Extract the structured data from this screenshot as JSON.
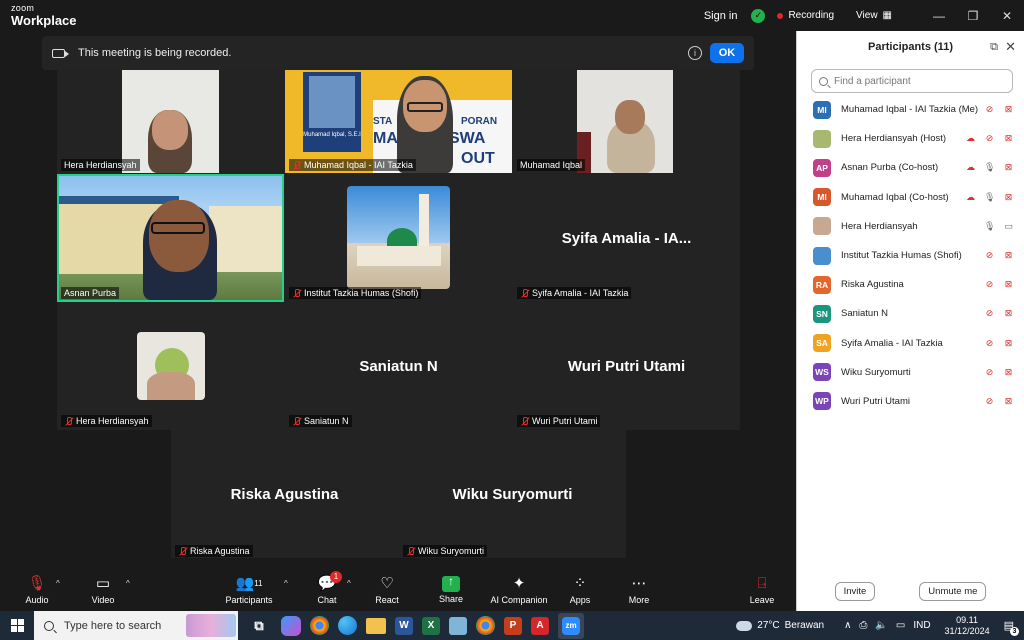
{
  "window": {
    "logo_line1": "zoom",
    "logo_line2": "Workplace",
    "sign_in": "Sign in",
    "recording_label": "Recording",
    "view_label": "View"
  },
  "banner": {
    "text": "This meeting is being recorded.",
    "ok_label": "OK"
  },
  "tiles": [
    {
      "name": "Hera Herdiansyah",
      "muted": false
    },
    {
      "name": "Muhamad Iqbal - IAI Tazkia",
      "muted": true
    },
    {
      "name": "Muhamad Iqbal",
      "muted": false
    },
    {
      "name": "Asnan Purba",
      "muted": false,
      "active": true
    },
    {
      "name": "Institut Tazkia Humas (Shofi)",
      "muted": true
    },
    {
      "name": "Syifa Amalia - IAI Tazkia",
      "muted": true,
      "display": "Syifa Amalia - IA..."
    },
    {
      "name": "Hera Herdiansyah",
      "muted": true
    },
    {
      "name": "Saniatun N",
      "muted": true,
      "display": "Saniatun N"
    },
    {
      "name": "Wuri Putri Utami",
      "muted": true,
      "display": "Wuri Putri Utami"
    },
    {
      "name": "Riska Agustina",
      "muted": true,
      "display": "Riska Agustina"
    },
    {
      "name": "Wiku Suryomurti",
      "muted": true,
      "display": "Wiku Suryomurti"
    }
  ],
  "slide_text": {
    "line1": "STA",
    "line2": "PORAN",
    "line3": "MA",
    "line4": "SWA",
    "line5": "OUT",
    "card_name": "Muhamad Iqbal, S.E.I"
  },
  "panel": {
    "title": "Participants (11)",
    "search_placeholder": "Find a participant",
    "invite_label": "Invite",
    "unmute_label": "Unmute me",
    "participants": [
      {
        "initials": "MI",
        "color": "#2d6fb5",
        "name": "Muhamad Iqbal - IAI Tazkia (Me)",
        "icons": [
          "mic-off",
          "video-off"
        ],
        "rec": false,
        "photo": false
      },
      {
        "initials": "",
        "color": "#a8b870",
        "name": "Hera Herdiansyah (Host)",
        "icons": [
          "mic-off",
          "video-off"
        ],
        "rec": true,
        "photo": true
      },
      {
        "initials": "AP",
        "color": "#c0408a",
        "name": "Asnan Purba (Co-host)",
        "icons": [
          "mic-on",
          "video-off"
        ],
        "rec": true,
        "photo": false
      },
      {
        "initials": "MI",
        "color": "#d9582b",
        "name": "Muhamad Iqbal (Co-host)",
        "icons": [
          "mic-on",
          "video-off"
        ],
        "rec": true,
        "photo": false
      },
      {
        "initials": "",
        "color": "#c8a890",
        "name": "Hera Herdiansyah",
        "icons": [
          "mic-on",
          "video-on"
        ],
        "rec": false,
        "photo": true
      },
      {
        "initials": "",
        "color": "#4a8ed0",
        "name": "Institut Tazkia Humas (Shofi)",
        "icons": [
          "mic-off",
          "video-off"
        ],
        "rec": false,
        "photo": true
      },
      {
        "initials": "RA",
        "color": "#e3672b",
        "name": "Riska Agustina",
        "icons": [
          "mic-off",
          "video-off"
        ],
        "rec": false,
        "photo": false
      },
      {
        "initials": "SN",
        "color": "#19967c",
        "name": "Saniatun N",
        "icons": [
          "mic-off",
          "video-off"
        ],
        "rec": false,
        "photo": false
      },
      {
        "initials": "SA",
        "color": "#efa321",
        "name": "Syifa Amalia - IAI Tazkia",
        "icons": [
          "mic-off",
          "video-off"
        ],
        "rec": false,
        "photo": false
      },
      {
        "initials": "WS",
        "color": "#7b45b8",
        "name": "Wiku Suryomurti",
        "icons": [
          "mic-off",
          "video-off"
        ],
        "rec": false,
        "photo": false
      },
      {
        "initials": "WP",
        "color": "#7b45b8",
        "name": "Wuri Putri Utami",
        "icons": [
          "mic-off",
          "video-off"
        ],
        "rec": false,
        "photo": false
      }
    ]
  },
  "toolbar": {
    "audio": "Audio",
    "video": "Video",
    "participants": "Participants",
    "participants_count": "11",
    "chat": "Chat",
    "chat_badge": "1",
    "react": "React",
    "share": "Share",
    "ai": "AI Companion",
    "apps": "Apps",
    "more": "More",
    "leave": "Leave"
  },
  "taskbar": {
    "search_placeholder": "Type here to search",
    "temperature": "27°C",
    "weather": "Berawan",
    "language": "IND",
    "time": "09.11",
    "date": "31/12/2024",
    "notif_count": "3"
  },
  "colors": {
    "accent": "#0e72ed",
    "active_speaker": "#23d18b",
    "muted": "#e03030",
    "recording": "#e02828"
  }
}
